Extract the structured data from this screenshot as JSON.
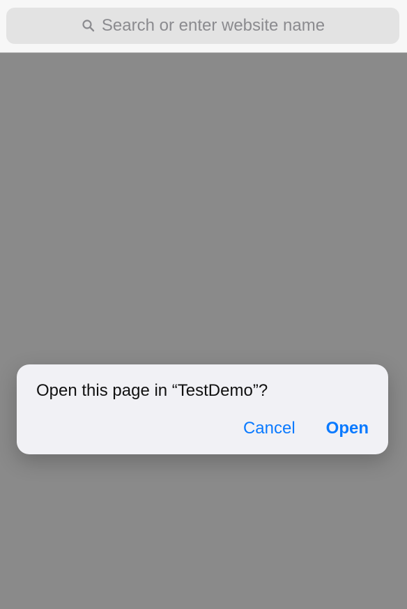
{
  "toolbar": {
    "search_placeholder": "Search or enter website name"
  },
  "dialog": {
    "message": "Open this page in “TestDemo”?",
    "cancel_label": "Cancel",
    "open_label": "Open"
  },
  "icons": {
    "search": "magnifying-glass"
  },
  "colors": {
    "accent": "#0a7aff",
    "overlay": "#8a8a8a",
    "dialog_background": "#f1f1f5"
  }
}
